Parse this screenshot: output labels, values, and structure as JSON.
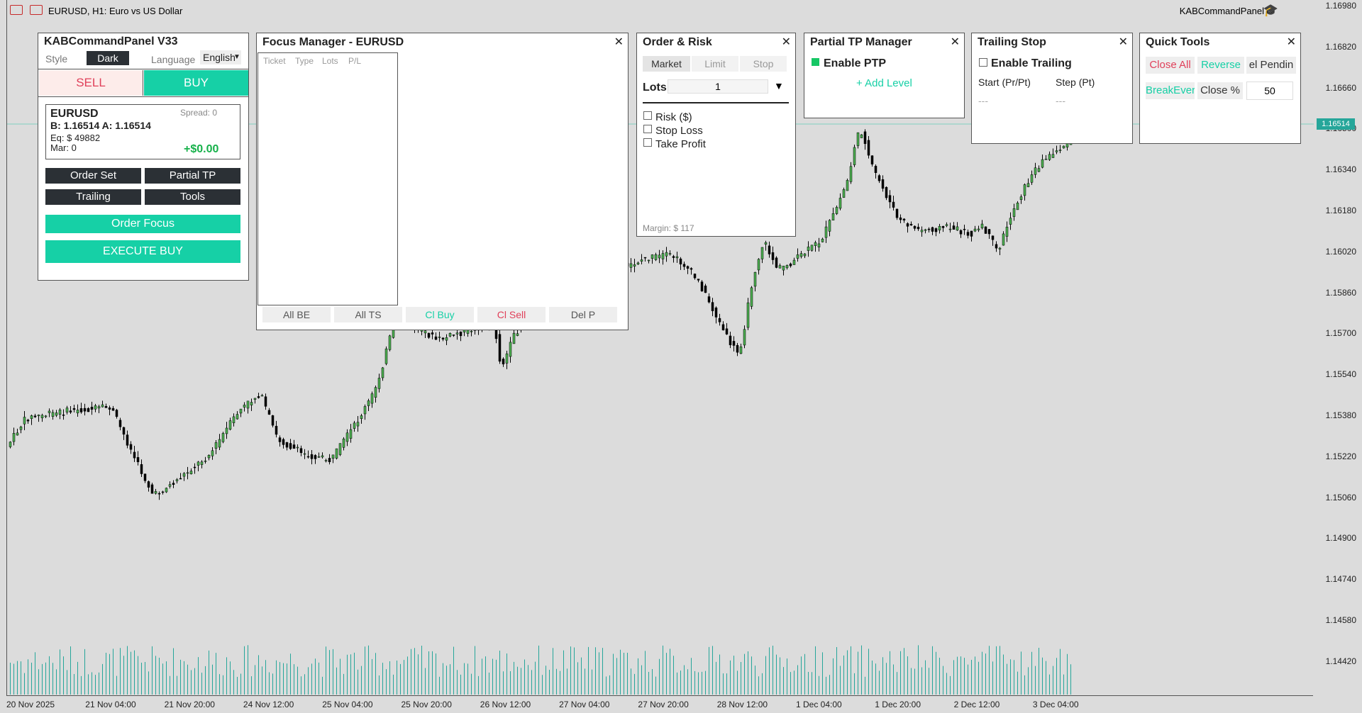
{
  "chart": {
    "title": "EURUSD, H1:  Euro vs US Dollar",
    "ea_name": "KABCommandPanel",
    "current_price": "1.16514",
    "price_axis": [
      "1.16980",
      "1.16820",
      "1.16660",
      "1.16500",
      "1.16340",
      "1.16180",
      "1.16020",
      "1.15860",
      "1.15700",
      "1.15540",
      "1.15380",
      "1.15220",
      "1.15060",
      "1.14900",
      "1.14740",
      "1.14580",
      "1.14420"
    ],
    "time_axis": [
      "20 Nov 2025",
      "21 Nov 04:00",
      "21 Nov 20:00",
      "24 Nov 12:00",
      "25 Nov 04:00",
      "25 Nov 20:00",
      "26 Nov 12:00",
      "27 Nov 04:00",
      "27 Nov 20:00",
      "28 Nov 12:00",
      "1 Dec 04:00",
      "1 Dec 20:00",
      "2 Dec 12:00",
      "3 Dec 04:00"
    ],
    "colors": {
      "bull": "#4caf50",
      "bear": "#000000",
      "volume": "#26a69a",
      "background": "#dcdcdc"
    }
  },
  "command_panel": {
    "title": "KABCommandPanel  V33",
    "style_label": "Style",
    "style_value": "Dark",
    "language_label": "Language",
    "language_value": "English",
    "sell_label": "SELL",
    "buy_label": "BUY",
    "symbol": "EURUSD",
    "spread": "Spread: 0",
    "bid_ask": "B: 1.16514  A: 1.16514",
    "equity": "Eq: $ 49882",
    "margin": "Mar: 0",
    "pnl": "+$0.00",
    "nav_buttons": [
      "Order Set",
      "Partial TP",
      "Trailing",
      "Tools"
    ],
    "order_focus_label": "Order Focus",
    "execute_label": "EXECUTE BUY"
  },
  "focus_manager": {
    "title": "Focus Manager - EURUSD",
    "columns": [
      "Ticket",
      "Type",
      "Lots",
      "P/L"
    ],
    "buttons": [
      {
        "label": "All BE",
        "color": "#555555"
      },
      {
        "label": "All TS",
        "color": "#555555"
      },
      {
        "label": "Cl Buy",
        "color": "#16d0a6"
      },
      {
        "label": "Cl Sell",
        "color": "#e0405a"
      },
      {
        "label": "Del P",
        "color": "#555555"
      }
    ]
  },
  "order_risk": {
    "title": "Order & Risk",
    "tabs": [
      "Market",
      "Limit",
      "Stop"
    ],
    "lots_label": "Lots",
    "lots_value": "1",
    "options": [
      "Risk ($)",
      "Stop Loss",
      "Take Profit"
    ],
    "margin_text": "Margin: $ 117"
  },
  "partial_tp": {
    "title": "Partial TP Manager",
    "enable_label": "Enable PTP",
    "add_level_label": "+ Add Level"
  },
  "trailing_stop": {
    "title": "Trailing Stop",
    "enable_label": "Enable Trailing",
    "start_label": "Start (Pr/Pt)",
    "step_label": "Step (Pt)",
    "start_value": "---",
    "step_value": "---"
  },
  "quick_tools": {
    "title": "Quick Tools",
    "close_all": "Close All",
    "reverse": "Reverse",
    "del_pending": "el Pendin",
    "breakeven": "BreakEver",
    "close_pct": "Close %",
    "pct_value": "50"
  }
}
